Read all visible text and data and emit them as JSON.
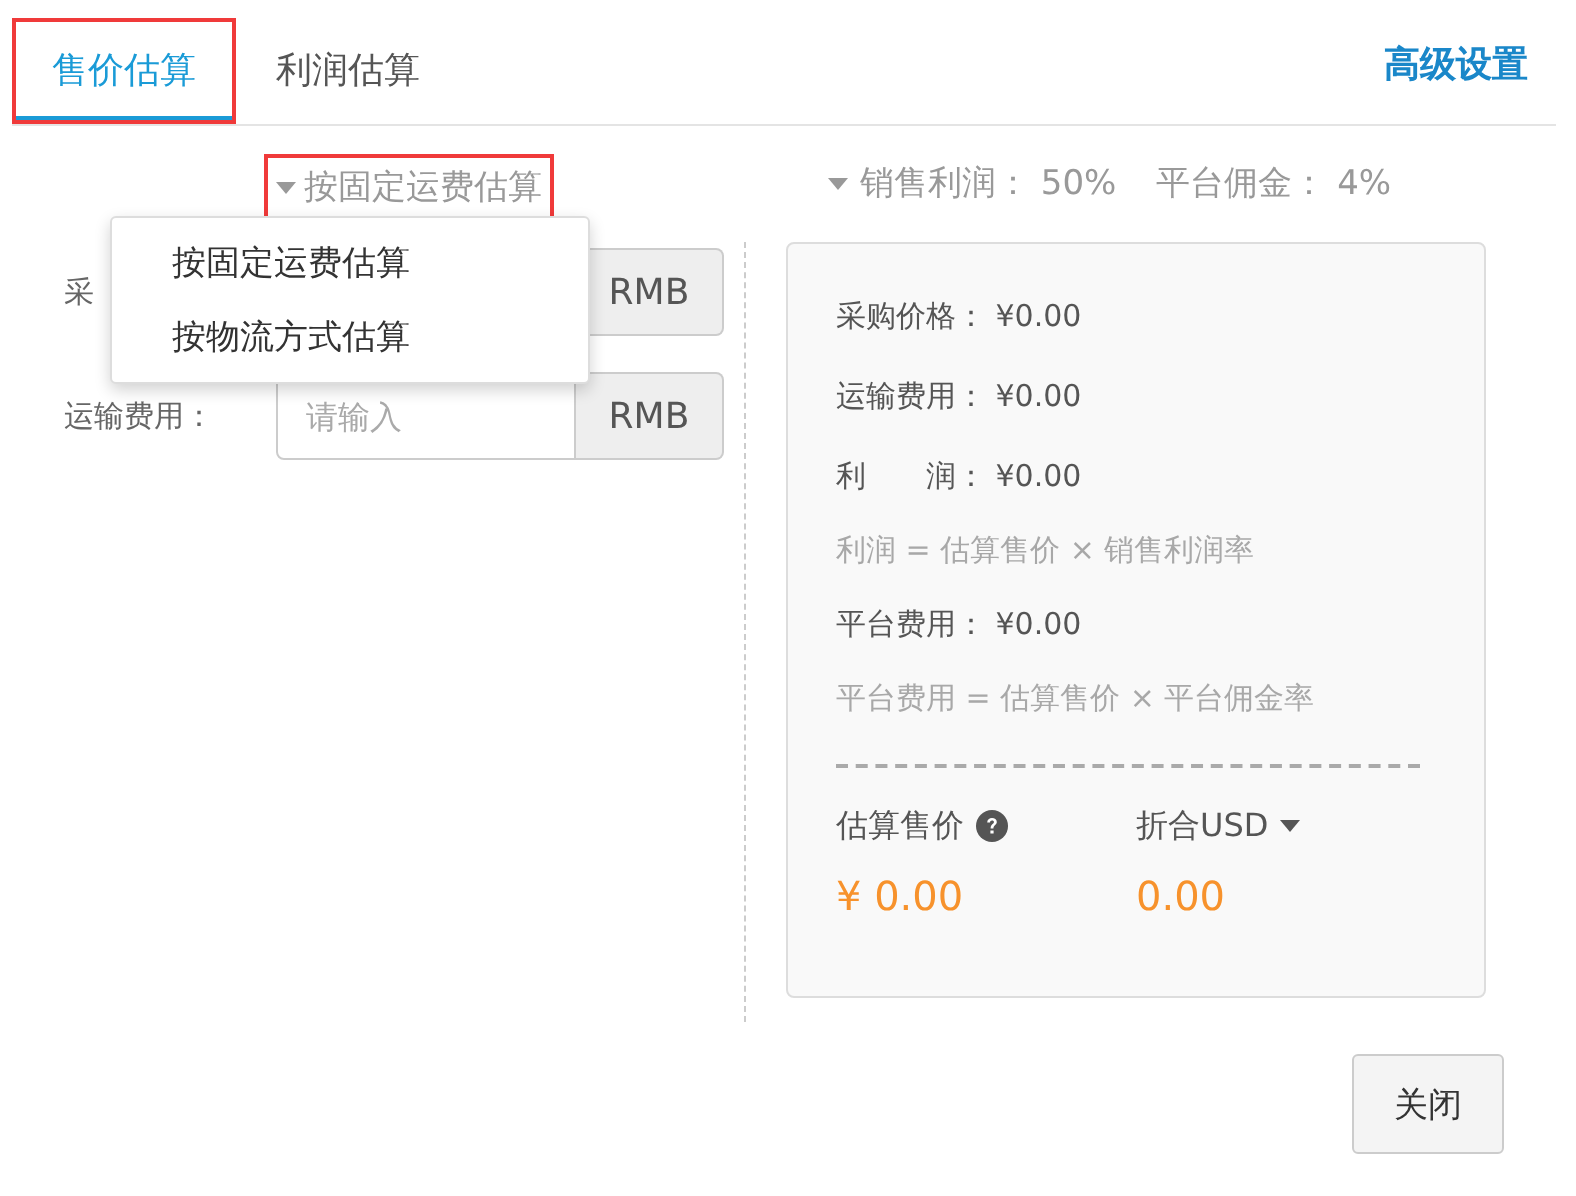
{
  "tabs": [
    {
      "label": "售价估算",
      "selected": true,
      "highlighted": true
    },
    {
      "label": "利润估算",
      "selected": false,
      "highlighted": false
    }
  ],
  "advanced_link": "高级设置",
  "mode_select": {
    "label": "按固定运费估算",
    "highlighted": true,
    "expanded": true,
    "options": [
      {
        "label": "按固定运费估算"
      },
      {
        "label": "按物流方式估算"
      }
    ]
  },
  "fields": [
    {
      "label": "采",
      "addon": "RMB"
    },
    {
      "label": "运输费用：",
      "placeholder": "请输入",
      "addon": "RMB"
    }
  ],
  "rates": [
    {
      "label": "销售利润：",
      "value": "50%"
    },
    {
      "label": "平台佣金：",
      "value": "4%"
    }
  ],
  "summary": [
    {
      "kind": "line",
      "label": "采购价格：",
      "value": "¥0.00"
    },
    {
      "kind": "line",
      "label": "运输费用：",
      "value": "¥0.00"
    },
    {
      "kind": "line",
      "label": "利　　润：",
      "value": "¥0.00"
    },
    {
      "kind": "note",
      "text": "利润 = 估算售价 × 销售利润率"
    },
    {
      "kind": "line",
      "label": "平台费用：",
      "value": "¥0.00"
    },
    {
      "kind": "note",
      "text": "平台费用 = 估算售价 × 平台佣金率"
    },
    {
      "kind": "rule"
    }
  ],
  "result": {
    "price_label": "估算售价",
    "currency_label": "折合USD",
    "price": "¥ 0.00",
    "converted": "0.00"
  },
  "close_button": "关闭"
}
